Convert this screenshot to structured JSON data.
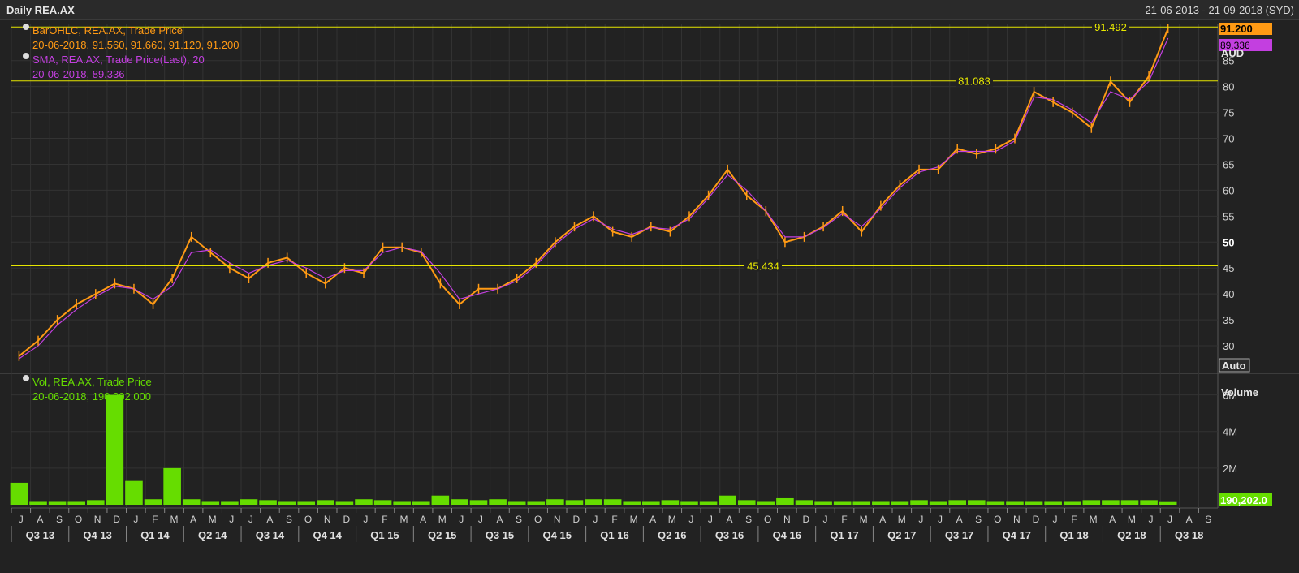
{
  "window": {
    "title": "Daily REA.AX",
    "date_range": "21-06-2013 - 21-09-2018 (SYD)"
  },
  "legend": {
    "bar_label": "BarOHLC, REA.AX, Trade Price",
    "bar_values": "20-06-2018, 91.560, 91.660, 91.120, 91.200",
    "sma_label": "SMA, REA.AX, Trade Price(Last),  20",
    "sma_values": "20-06-2018, 89.336",
    "vol_label": "Vol, REA.AX, Trade Price",
    "vol_values": "20-06-2018, 190,202.000"
  },
  "colors": {
    "price": "#ff9a14",
    "sma": "#c33fe0",
    "volume": "#66dd00",
    "hline": "#e6e600",
    "grid": "#333333"
  },
  "price_panel": {
    "currency": "AUD",
    "last_price_tag": "91.200",
    "sma_tag": "89.336",
    "auto_label": "Auto",
    "y_ticks": [
      "30",
      "35",
      "40",
      "45",
      "50",
      "55",
      "60",
      "65",
      "70",
      "75",
      "80",
      "85"
    ],
    "y_range": [
      25,
      92
    ]
  },
  "hlines": [
    {
      "value": 91.492,
      "label": "91.492"
    },
    {
      "value": 81.083,
      "label": "81.083"
    },
    {
      "value": 45.434,
      "label": "45.434"
    }
  ],
  "volume_panel": {
    "title": "Volume",
    "y_ticks": [
      "2M",
      "4M",
      "6M"
    ],
    "y_range": [
      0,
      7000000
    ],
    "last_tag": "190,202.0"
  },
  "x_axis": {
    "months": [
      "J",
      "A",
      "S",
      "O",
      "N",
      "D",
      "J",
      "F",
      "M",
      "A",
      "M",
      "J",
      "J",
      "A",
      "S",
      "O",
      "N",
      "D",
      "J",
      "F",
      "M",
      "A",
      "M",
      "J",
      "J",
      "A",
      "S",
      "O",
      "N",
      "D",
      "J",
      "F",
      "M",
      "A",
      "M",
      "J",
      "J",
      "A",
      "S",
      "O",
      "N",
      "D",
      "J",
      "F",
      "M",
      "A",
      "M",
      "J",
      "J",
      "A",
      "S",
      "O",
      "N",
      "D",
      "J",
      "F",
      "M",
      "A",
      "M",
      "J",
      "J",
      "A",
      "S"
    ],
    "quarters": [
      "Q3 13",
      "Q4 13",
      "Q1 14",
      "Q2 14",
      "Q3 14",
      "Q4 14",
      "Q1 15",
      "Q2 15",
      "Q3 15",
      "Q4 15",
      "Q1 16",
      "Q2 16",
      "Q3 16",
      "Q4 16",
      "Q1 17",
      "Q2 17",
      "Q3 17",
      "Q4 17",
      "Q1 18",
      "Q2 18",
      "Q3 18"
    ]
  },
  "chart_data": {
    "type": "line",
    "x": [
      "2013-06",
      "2013-07",
      "2013-08",
      "2013-09",
      "2013-10",
      "2013-11",
      "2013-12",
      "2014-01",
      "2014-02",
      "2014-03",
      "2014-04",
      "2014-05",
      "2014-06",
      "2014-07",
      "2014-08",
      "2014-09",
      "2014-10",
      "2014-11",
      "2014-12",
      "2015-01",
      "2015-02",
      "2015-03",
      "2015-04",
      "2015-05",
      "2015-06",
      "2015-07",
      "2015-08",
      "2015-09",
      "2015-10",
      "2015-11",
      "2015-12",
      "2016-01",
      "2016-02",
      "2016-03",
      "2016-04",
      "2016-05",
      "2016-06",
      "2016-07",
      "2016-08",
      "2016-09",
      "2016-10",
      "2016-11",
      "2016-12",
      "2017-01",
      "2017-02",
      "2017-03",
      "2017-04",
      "2017-05",
      "2017-06",
      "2017-07",
      "2017-08",
      "2017-09",
      "2017-10",
      "2017-11",
      "2017-12",
      "2018-01",
      "2018-02",
      "2018-03",
      "2018-04",
      "2018-05",
      "2018-06"
    ],
    "series": [
      {
        "name": "BarOHLC, REA.AX, Trade Price",
        "values": [
          28,
          31,
          35,
          38,
          40,
          42,
          41,
          38,
          43,
          51,
          48,
          45,
          43,
          46,
          47,
          44,
          42,
          45,
          44,
          49,
          49,
          48,
          42,
          38,
          41,
          41,
          43,
          46,
          50,
          53,
          55,
          52,
          51,
          53,
          52,
          55,
          59,
          64,
          59,
          56,
          50,
          51,
          53,
          56,
          52,
          57,
          61,
          64,
          64,
          68,
          67,
          68,
          70,
          79,
          77,
          75,
          72,
          81,
          77,
          82,
          91.2
        ]
      },
      {
        "name": "SMA, REA.AX, Trade Price(Last),  20",
        "values": [
          27.5,
          30,
          34,
          37,
          39.5,
          41.5,
          41,
          39,
          41.5,
          48,
          48.5,
          46,
          44,
          45.5,
          46.5,
          45,
          43,
          44.5,
          44.5,
          48,
          49,
          48.2,
          44,
          39,
          40,
          41,
          42.5,
          45.5,
          49.5,
          52.5,
          54.5,
          52.5,
          51.5,
          52.8,
          52.5,
          54.5,
          58.5,
          63,
          60,
          56,
          51,
          51,
          52.8,
          55.5,
          53,
          56.5,
          60.5,
          63.5,
          64.5,
          67.5,
          67.5,
          67.5,
          69.5,
          78,
          77.5,
          75.5,
          73,
          79,
          77.5,
          81,
          89.336
        ]
      }
    ],
    "volume": [
      1.2,
      0.2,
      0.2,
      0.2,
      0.25,
      6.0,
      1.3,
      0.3,
      2.0,
      0.3,
      0.2,
      0.2,
      0.3,
      0.25,
      0.2,
      0.2,
      0.25,
      0.2,
      0.3,
      0.25,
      0.2,
      0.2,
      0.5,
      0.3,
      0.25,
      0.3,
      0.2,
      0.2,
      0.3,
      0.25,
      0.3,
      0.3,
      0.2,
      0.2,
      0.25,
      0.2,
      0.2,
      0.5,
      0.25,
      0.2,
      0.4,
      0.25,
      0.2,
      0.2,
      0.2,
      0.2,
      0.2,
      0.25,
      0.2,
      0.25,
      0.25,
      0.2,
      0.2,
      0.2,
      0.2,
      0.2,
      0.25,
      0.25,
      0.25,
      0.25,
      0.19
    ],
    "volume_unit": "millions",
    "ylabel": "AUD",
    "ylim": [
      25,
      92
    ],
    "grid": true
  }
}
